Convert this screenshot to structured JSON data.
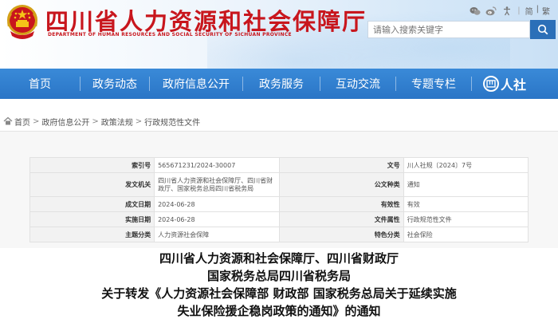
{
  "header": {
    "title": "四川省人力资源和社会保障厅",
    "subtitle": "DEPARTMENT OF HUMAN RESOURCES AND SOCIAL SECURITY OF SICHUAN PROVINCE",
    "lang_simplified": "简",
    "lang_separator": "|",
    "lang_traditional": "繁",
    "search_placeholder": "请输入搜索关键字",
    "accent_color": "#c8161d",
    "icons": [
      "wechat-icon",
      "weibo-icon",
      "accessibility-icon"
    ]
  },
  "nav": {
    "items": [
      {
        "label": "首页"
      },
      {
        "label": "政务动态"
      },
      {
        "label": "政府信息公开"
      },
      {
        "label": "政务服务"
      },
      {
        "label": "互动交流"
      },
      {
        "label": "专题专栏"
      }
    ],
    "logo_text": "人社",
    "color": "#2f7fcf"
  },
  "breadcrumb": {
    "items": [
      "首页",
      "政府信息公开",
      "政策法规",
      "行政规范性文件"
    ],
    "separator": ">"
  },
  "info": {
    "rows": [
      {
        "l1": "索引号",
        "v1": "565671231/2024-30007",
        "l2": "文号",
        "v2": "川人社规〔2024〕7号"
      },
      {
        "l1": "发文机关",
        "v1a": "四川省人力资源和社会保障厅、四川省财",
        "v1b": "政厅、国家税务总局四川省税务局",
        "l2": "公文种类",
        "v2": "通知"
      },
      {
        "l1": "成文日期",
        "v1": "2024-06-28",
        "l2": "有效性",
        "v2": "有效"
      },
      {
        "l1": "实施日期",
        "v1": "2024-06-28",
        "l2": "文件属性",
        "v2": "行政规范性文件"
      },
      {
        "l1": "主题分类",
        "v1": "人力资源社会保障",
        "l2": "特色分类",
        "v2": "社会保险"
      }
    ]
  },
  "article": {
    "title_lines": [
      "四川省人力资源和社会保障厅、四川省财政厅",
      "国家税务总局四川省税务局",
      "关于转发《人力资源社会保障部 财政部  国家税务总局关于延续实施",
      "失业保险援企稳岗政策的通知》的通知"
    ]
  }
}
